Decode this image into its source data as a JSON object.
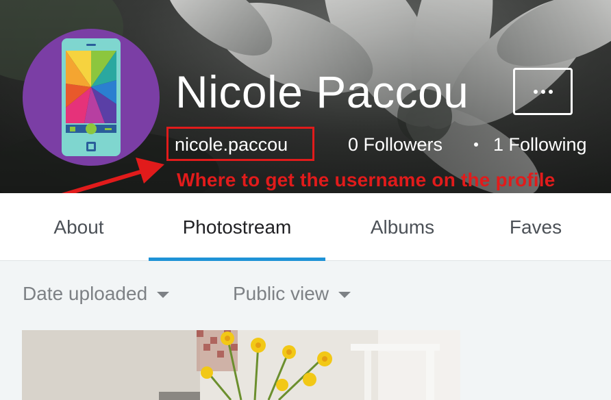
{
  "profile": {
    "name": "Nicole Paccou",
    "username": "nicole.paccou",
    "followers": "0 Followers",
    "following": "1 Following",
    "more_icon": "more-dots-icon"
  },
  "annotation": {
    "text": "Where to get the username on the profile",
    "color": "#e11b1b"
  },
  "tabs": [
    {
      "label": "About",
      "active": false
    },
    {
      "label": "Photostream",
      "active": true
    },
    {
      "label": "Albums",
      "active": false
    },
    {
      "label": "Faves",
      "active": false
    }
  ],
  "filters": {
    "sort": "Date uploaded",
    "view": "Public view"
  },
  "colors": {
    "accent": "#1e92d6",
    "avatar_bg": "#7b3ea5"
  }
}
